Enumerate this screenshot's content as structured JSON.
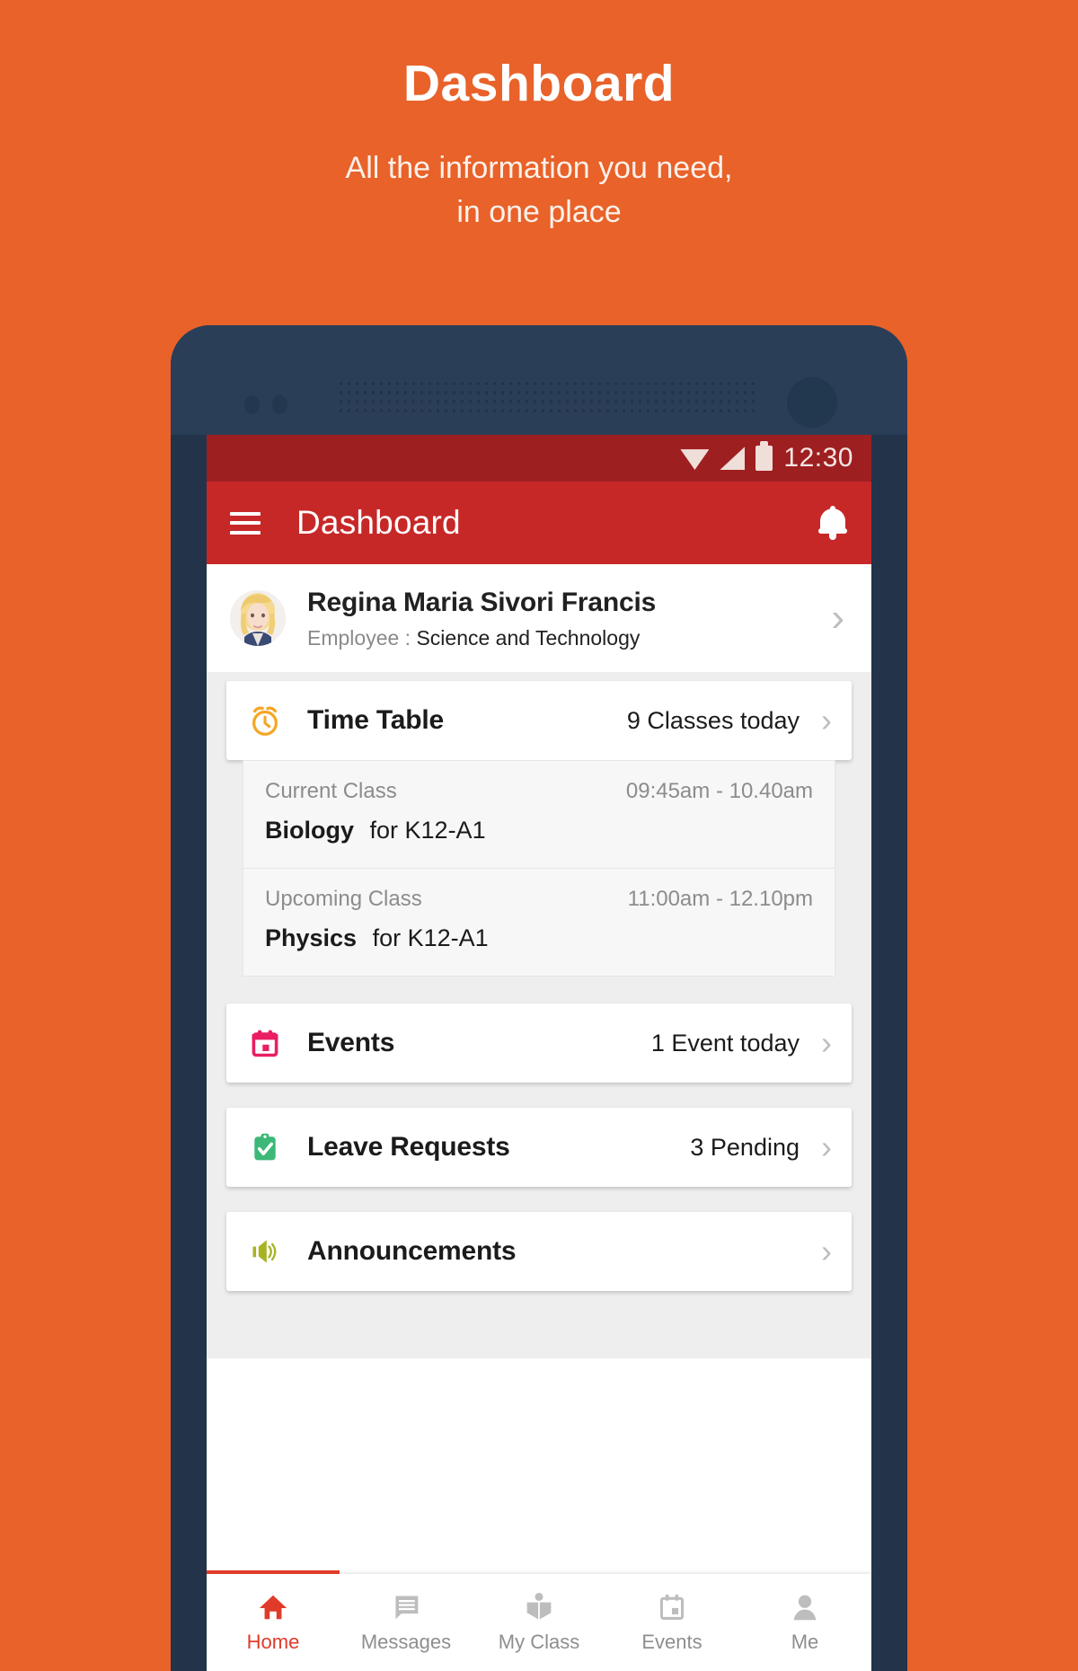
{
  "promo": {
    "title": "Dashboard",
    "subtitle_line1": "All the information you need,",
    "subtitle_line2": "in one place",
    "background_color": "#e8622a"
  },
  "statusbar": {
    "time": "12:30",
    "icons": [
      "wifi-icon",
      "cellular-signal-icon",
      "battery-icon"
    ],
    "background_color": "#9e1f20"
  },
  "appbar": {
    "menu_icon": "hamburger-menu-icon",
    "title": "Dashboard",
    "notification_icon": "bell-icon",
    "background_color": "#c62828"
  },
  "profile": {
    "name": "Regina Maria Sivori Francis",
    "role_label": "Employee :",
    "role_value": "Science and Technology",
    "chevron": "›"
  },
  "cards": {
    "time_table": {
      "icon": "alarm-clock-icon",
      "icon_color": "#f5a623",
      "title": "Time Table",
      "meta": "9 Classes today",
      "chevron": "›",
      "details": [
        {
          "label": "Current Class",
          "time": "09:45am - 10.40am",
          "subject": "Biology",
          "for": "for K12-A1"
        },
        {
          "label": "Upcoming Class",
          "time": "11:00am - 12.10pm",
          "subject": "Physics",
          "for": "for K12-A1"
        }
      ]
    },
    "events": {
      "icon": "calendar-icon",
      "icon_color": "#e91e63",
      "title": "Events",
      "meta": "1 Event today",
      "chevron": "›"
    },
    "leave_requests": {
      "icon": "clipboard-check-icon",
      "icon_color": "#3cb878",
      "title": "Leave Requests",
      "meta": "3 Pending",
      "chevron": "›"
    },
    "announcements": {
      "icon": "megaphone-icon",
      "icon_color": "#a8b324",
      "title": "Announcements",
      "meta": "",
      "chevron": "›"
    }
  },
  "bottom_nav": {
    "active_color": "#e03b2a",
    "inactive_color": "#8e8e8e",
    "items": [
      {
        "label": "Home",
        "icon": "home-icon",
        "active": true
      },
      {
        "label": "Messages",
        "icon": "message-icon",
        "active": false
      },
      {
        "label": "My Class",
        "icon": "open-book-icon",
        "active": false
      },
      {
        "label": "Events",
        "icon": "calendar-icon",
        "active": false
      },
      {
        "label": "Me",
        "icon": "person-icon",
        "active": false
      }
    ]
  }
}
